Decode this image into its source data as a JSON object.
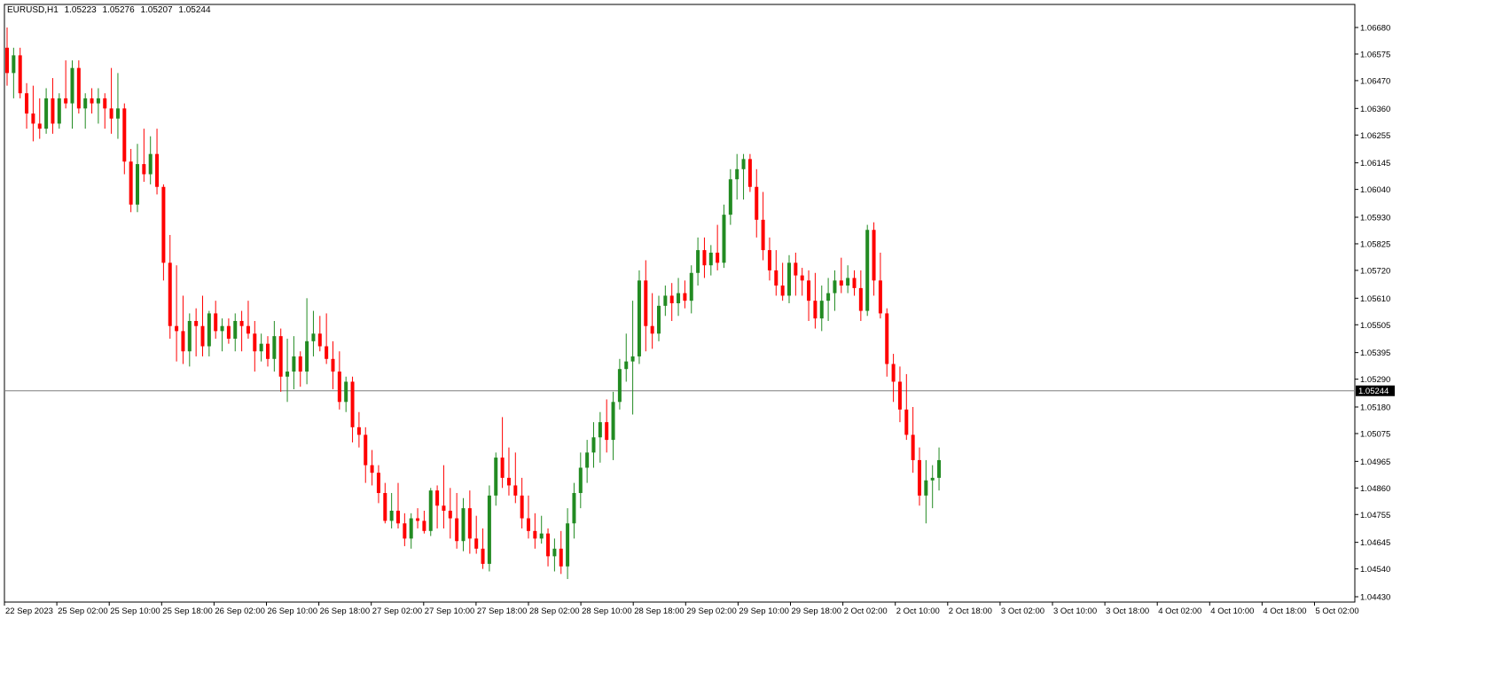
{
  "header": {
    "symbol": "EURUSD,H1",
    "open": "1.05223",
    "high": "1.05276",
    "low": "1.05207",
    "close": "1.05244"
  },
  "colors": {
    "bull": "#228B22",
    "bear": "#FF0000",
    "wick_bull": "#228B22",
    "wick_bear": "#FF0000",
    "price_line": "#7f7f7f",
    "price_box": "#000000"
  },
  "chart_data": {
    "type": "candlestick",
    "title": "",
    "ylim": [
      1.0443,
      1.0668
    ],
    "current_price": 1.05244,
    "current_price_label": "1.05244",
    "y_ticks": [
      "1.06680",
      "1.06575",
      "1.06470",
      "1.06360",
      "1.06255",
      "1.06145",
      "1.06040",
      "1.05930",
      "1.05825",
      "1.05720",
      "1.05610",
      "1.05505",
      "1.05395",
      "1.05290",
      "1.05180",
      "1.05075",
      "1.04965",
      "1.04860",
      "1.04755",
      "1.04645",
      "1.04540",
      "1.04430"
    ],
    "x_ticks": [
      "22 Sep 2023",
      "25 Sep 02:00",
      "25 Sep 10:00",
      "25 Sep 18:00",
      "26 Sep 02:00",
      "26 Sep 10:00",
      "26 Sep 18:00",
      "27 Sep 02:00",
      "27 Sep 10:00",
      "27 Sep 18:00",
      "28 Sep 02:00",
      "28 Sep 10:00",
      "28 Sep 18:00",
      "29 Sep 02:00",
      "29 Sep 10:00",
      "29 Sep 18:00",
      "2 Oct 02:00",
      "2 Oct 10:00",
      "2 Oct 18:00",
      "3 Oct 02:00",
      "3 Oct 10:00",
      "3 Oct 18:00",
      "4 Oct 02:00",
      "4 Oct 10:00",
      "4 Oct 18:00",
      "5 Oct 02:00"
    ],
    "candles": [
      [
        1.066,
        1.0668,
        1.0645,
        1.065
      ],
      [
        1.065,
        1.066,
        1.064,
        1.0657
      ],
      [
        1.0657,
        1.066,
        1.064,
        1.0642
      ],
      [
        1.0642,
        1.0646,
        1.0628,
        1.0634
      ],
      [
        1.0634,
        1.0645,
        1.0623,
        1.063
      ],
      [
        1.063,
        1.064,
        1.0624,
        1.0628
      ],
      [
        1.0628,
        1.0644,
        1.0626,
        1.064
      ],
      [
        1.064,
        1.0648,
        1.0626,
        1.063
      ],
      [
        1.063,
        1.0642,
        1.0628,
        1.064
      ],
      [
        1.064,
        1.0655,
        1.0636,
        1.0638
      ],
      [
        1.0638,
        1.0655,
        1.0628,
        1.0652
      ],
      [
        1.0652,
        1.0655,
        1.0634,
        1.0636
      ],
      [
        1.0636,
        1.0642,
        1.0628,
        1.064
      ],
      [
        1.064,
        1.0644,
        1.0634,
        1.0638
      ],
      [
        1.0638,
        1.0644,
        1.063,
        1.064
      ],
      [
        1.064,
        1.0642,
        1.0628,
        1.0636
      ],
      [
        1.0636,
        1.0652,
        1.0626,
        1.0632
      ],
      [
        1.0632,
        1.065,
        1.0624,
        1.0636
      ],
      [
        1.0636,
        1.0638,
        1.061,
        1.0615
      ],
      [
        1.0615,
        1.062,
        1.0595,
        1.0598
      ],
      [
        1.0598,
        1.0622,
        1.0595,
        1.0614
      ],
      [
        1.0614,
        1.0628,
        1.0607,
        1.061
      ],
      [
        1.061,
        1.0625,
        1.0606,
        1.0618
      ],
      [
        1.0618,
        1.0628,
        1.0602,
        1.0605
      ],
      [
        1.0605,
        1.0606,
        1.0568,
        1.0575
      ],
      [
        1.0575,
        1.0586,
        1.0545,
        1.055
      ],
      [
        1.055,
        1.0574,
        1.0536,
        1.0548
      ],
      [
        1.0548,
        1.0562,
        1.0535,
        1.054
      ],
      [
        1.054,
        1.0555,
        1.0534,
        1.0552
      ],
      [
        1.0552,
        1.0557,
        1.0538,
        1.055
      ],
      [
        1.055,
        1.0562,
        1.0538,
        1.0542
      ],
      [
        1.0542,
        1.0556,
        1.0538,
        1.0555
      ],
      [
        1.0555,
        1.056,
        1.0545,
        1.0548
      ],
      [
        1.0548,
        1.0553,
        1.054,
        1.055
      ],
      [
        1.055,
        1.0553,
        1.0543,
        1.0545
      ],
      [
        1.0545,
        1.0555,
        1.054,
        1.0552
      ],
      [
        1.0552,
        1.0556,
        1.054,
        1.055
      ],
      [
        1.055,
        1.056,
        1.0545,
        1.0547
      ],
      [
        1.0547,
        1.0552,
        1.0532,
        1.054
      ],
      [
        1.054,
        1.0547,
        1.0536,
        1.0543
      ],
      [
        1.0543,
        1.0546,
        1.0534,
        1.0537
      ],
      [
        1.0537,
        1.0552,
        1.0532,
        1.0546
      ],
      [
        1.0546,
        1.0549,
        1.0524,
        1.053
      ],
      [
        1.053,
        1.0545,
        1.052,
        1.0532
      ],
      [
        1.0532,
        1.0546,
        1.0525,
        1.0538
      ],
      [
        1.0538,
        1.054,
        1.0526,
        1.0532
      ],
      [
        1.0532,
        1.0561,
        1.0527,
        1.0544
      ],
      [
        1.0544,
        1.0556,
        1.0538,
        1.0547
      ],
      [
        1.0547,
        1.0554,
        1.054,
        1.0542
      ],
      [
        1.0542,
        1.0555,
        1.0535,
        1.0537
      ],
      [
        1.0537,
        1.0544,
        1.0525,
        1.0532
      ],
      [
        1.0532,
        1.054,
        1.0517,
        1.052
      ],
      [
        1.052,
        1.053,
        1.0516,
        1.0528
      ],
      [
        1.0528,
        1.053,
        1.0504,
        1.051
      ],
      [
        1.051,
        1.0516,
        1.0502,
        1.0507
      ],
      [
        1.0507,
        1.051,
        1.0488,
        1.0495
      ],
      [
        1.0495,
        1.0501,
        1.0487,
        1.0492
      ],
      [
        1.0492,
        1.0495,
        1.048,
        1.0484
      ],
      [
        1.0484,
        1.0488,
        1.0472,
        1.0473
      ],
      [
        1.0473,
        1.0484,
        1.047,
        1.0477
      ],
      [
        1.0477,
        1.0488,
        1.047,
        1.0472
      ],
      [
        1.0472,
        1.0476,
        1.0463,
        1.0466
      ],
      [
        1.0466,
        1.0476,
        1.0462,
        1.0474
      ],
      [
        1.0474,
        1.0478,
        1.047,
        1.0473
      ],
      [
        1.0473,
        1.0477,
        1.0468,
        1.0469
      ],
      [
        1.0469,
        1.0486,
        1.0467,
        1.0485
      ],
      [
        1.0485,
        1.0487,
        1.047,
        1.0479
      ],
      [
        1.0479,
        1.0495,
        1.047,
        1.0477
      ],
      [
        1.0477,
        1.0486,
        1.0466,
        1.0474
      ],
      [
        1.0474,
        1.0484,
        1.0462,
        1.0465
      ],
      [
        1.0465,
        1.0482,
        1.0461,
        1.0478
      ],
      [
        1.0478,
        1.0485,
        1.046,
        1.0466
      ],
      [
        1.0466,
        1.0475,
        1.046,
        1.0462
      ],
      [
        1.0462,
        1.047,
        1.0454,
        1.0456
      ],
      [
        1.0456,
        1.0487,
        1.0453,
        1.0483
      ],
      [
        1.0483,
        1.05,
        1.0479,
        1.0498
      ],
      [
        1.0498,
        1.0514,
        1.0486,
        1.049
      ],
      [
        1.049,
        1.0502,
        1.0483,
        1.0487
      ],
      [
        1.0487,
        1.05,
        1.048,
        1.0483
      ],
      [
        1.0483,
        1.049,
        1.047,
        1.0474
      ],
      [
        1.0474,
        1.0483,
        1.0466,
        1.0469
      ],
      [
        1.0469,
        1.0476,
        1.0462,
        1.0466
      ],
      [
        1.0466,
        1.0475,
        1.0464,
        1.0468
      ],
      [
        1.0468,
        1.047,
        1.0455,
        1.0459
      ],
      [
        1.0459,
        1.0466,
        1.0453,
        1.0462
      ],
      [
        1.0462,
        1.0469,
        1.0452,
        1.0455
      ],
      [
        1.0455,
        1.0478,
        1.045,
        1.0472
      ],
      [
        1.0472,
        1.0488,
        1.0466,
        1.0484
      ],
      [
        1.0484,
        1.05,
        1.0478,
        1.0494
      ],
      [
        1.0494,
        1.0505,
        1.0488,
        1.05
      ],
      [
        1.05,
        1.0512,
        1.0494,
        1.0506
      ],
      [
        1.0506,
        1.0516,
        1.0496,
        1.0512
      ],
      [
        1.0512,
        1.0521,
        1.05,
        1.0505
      ],
      [
        1.0505,
        1.0524,
        1.0497,
        1.052
      ],
      [
        1.052,
        1.0537,
        1.0517,
        1.0533
      ],
      [
        1.0533,
        1.0547,
        1.0528,
        1.0536
      ],
      [
        1.0536,
        1.056,
        1.0515,
        1.0538
      ],
      [
        1.0538,
        1.0572,
        1.0535,
        1.0568
      ],
      [
        1.0568,
        1.0576,
        1.054,
        1.055
      ],
      [
        1.055,
        1.0563,
        1.0541,
        1.0547
      ],
      [
        1.0547,
        1.0562,
        1.0544,
        1.0558
      ],
      [
        1.0558,
        1.0566,
        1.0554,
        1.0562
      ],
      [
        1.0562,
        1.0567,
        1.0552,
        1.0559
      ],
      [
        1.0559,
        1.0569,
        1.0554,
        1.0563
      ],
      [
        1.0563,
        1.0568,
        1.0557,
        1.056
      ],
      [
        1.056,
        1.0574,
        1.0555,
        1.0571
      ],
      [
        1.0571,
        1.0585,
        1.0566,
        1.058
      ],
      [
        1.058,
        1.0585,
        1.0569,
        1.0574
      ],
      [
        1.0574,
        1.0582,
        1.057,
        1.0579
      ],
      [
        1.0579,
        1.059,
        1.0572,
        1.0575
      ],
      [
        1.0575,
        1.0598,
        1.0573,
        1.0594
      ],
      [
        1.0594,
        1.0612,
        1.059,
        1.0608
      ],
      [
        1.0608,
        1.0618,
        1.06,
        1.0612
      ],
      [
        1.0612,
        1.0618,
        1.06,
        1.0616
      ],
      [
        1.0616,
        1.0618,
        1.0603,
        1.0605
      ],
      [
        1.0605,
        1.0612,
        1.0585,
        1.0592
      ],
      [
        1.0592,
        1.0603,
        1.0576,
        1.058
      ],
      [
        1.058,
        1.0585,
        1.0568,
        1.0572
      ],
      [
        1.0572,
        1.058,
        1.0562,
        1.0566
      ],
      [
        1.0566,
        1.0575,
        1.056,
        1.0562
      ],
      [
        1.0562,
        1.0578,
        1.0559,
        1.0575
      ],
      [
        1.0575,
        1.0579,
        1.0562,
        1.057
      ],
      [
        1.057,
        1.0573,
        1.0562,
        1.0568
      ],
      [
        1.0568,
        1.0572,
        1.0552,
        1.056
      ],
      [
        1.056,
        1.0571,
        1.0549,
        1.0553
      ],
      [
        1.0553,
        1.0566,
        1.0548,
        1.056
      ],
      [
        1.056,
        1.0569,
        1.0552,
        1.0563
      ],
      [
        1.0563,
        1.0572,
        1.0556,
        1.0568
      ],
      [
        1.0568,
        1.0577,
        1.0563,
        1.0566
      ],
      [
        1.0566,
        1.0574,
        1.0563,
        1.0569
      ],
      [
        1.0569,
        1.0572,
        1.0562,
        1.0565
      ],
      [
        1.0565,
        1.0572,
        1.0552,
        1.0556
      ],
      [
        1.0556,
        1.059,
        1.0554,
        1.0588
      ],
      [
        1.0588,
        1.0591,
        1.0562,
        1.0568
      ],
      [
        1.0568,
        1.0579,
        1.0553,
        1.0555
      ],
      [
        1.0555,
        1.0557,
        1.053,
        1.0535
      ],
      [
        1.0535,
        1.0539,
        1.052,
        1.0528
      ],
      [
        1.0528,
        1.0534,
        1.0512,
        1.0517
      ],
      [
        1.0517,
        1.0531,
        1.0505,
        1.0507
      ],
      [
        1.0507,
        1.0518,
        1.0492,
        1.0497
      ],
      [
        1.0497,
        1.0502,
        1.0479,
        1.0483
      ],
      [
        1.0483,
        1.0497,
        1.0472,
        1.0489
      ],
      [
        1.0489,
        1.0495,
        1.0478,
        1.049
      ],
      [
        1.049,
        1.0502,
        1.0485,
        1.0497
      ]
    ]
  }
}
